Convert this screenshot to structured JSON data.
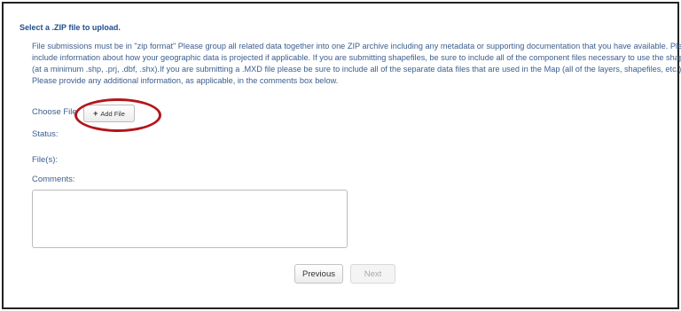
{
  "form": {
    "heading": "Select a .ZIP file to upload.",
    "instructions": [
      "File submissions must be in \"zip format\" Please group all related data together into one ZIP archive including any metadata or supporting documentation that you have available. Please",
      "include information about how your geographic data is projected if applicable. If you are submitting shapefiles, be sure to include all of the component files necessary to use the shapefile",
      "(at a minimum .shp, .prj, .dbf, .shx).If you are submitting a .MXD file please be sure to include all of the separate data files that are used in the Map (all of the layers, shapefiles, etc.).",
      "Please provide any additional information, as applicable, in the comments box below."
    ],
    "choose_file_label": "Choose File",
    "add_file_icon": "+",
    "add_file_label": "Add File",
    "status_label": "Status:",
    "files_label": "File(s):",
    "comments_label": "Comments:",
    "comments_value": "",
    "comments_placeholder": ""
  },
  "navigation": {
    "previous_label": "Previous",
    "next_label": "Next"
  },
  "colors": {
    "heading": "#1f4e8c",
    "text": "#3b5e8e",
    "highlight_ring": "#b3161b"
  },
  "icons": {
    "add_file": "plus-icon"
  }
}
